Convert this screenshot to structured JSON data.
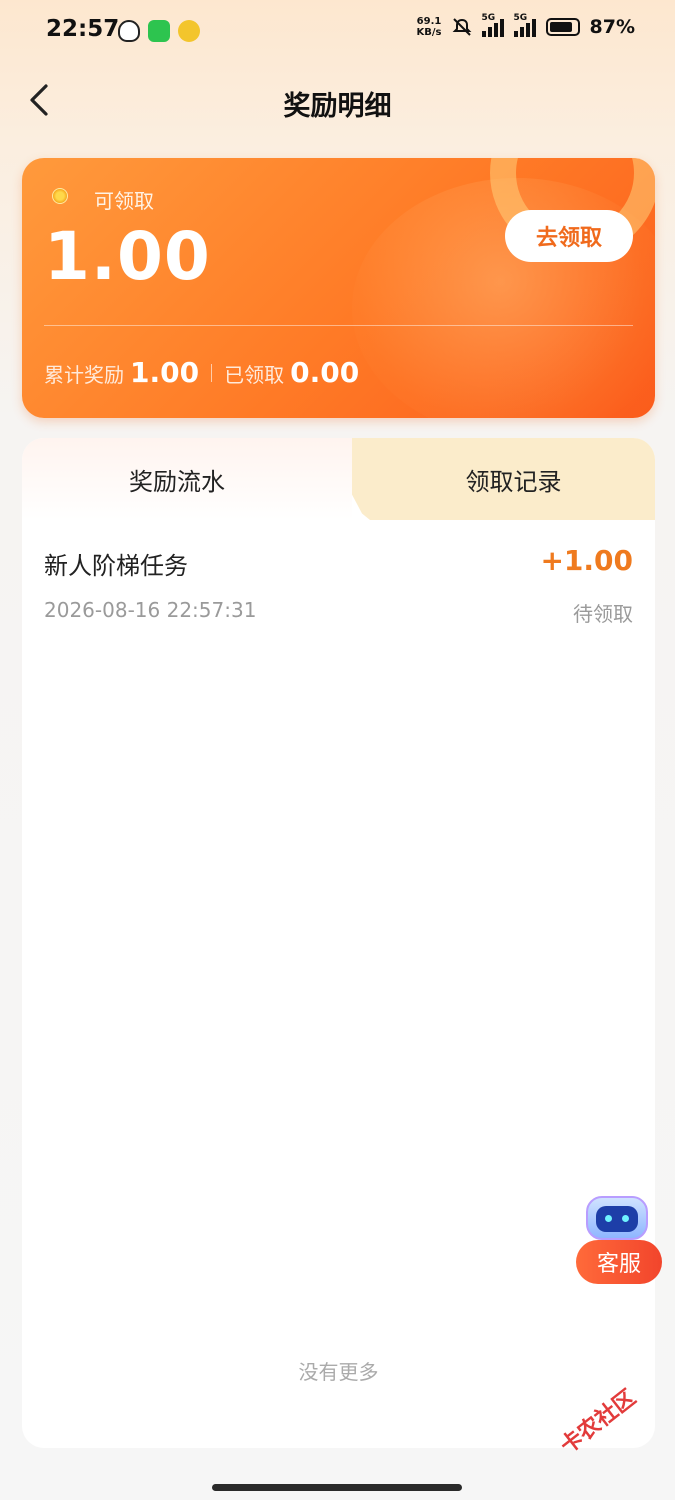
{
  "status_bar": {
    "time": "22:57",
    "net_speed_value": "69.1",
    "net_speed_unit": "KB/s",
    "signal_1": "5G",
    "signal_2": "5G",
    "battery": "87%"
  },
  "header": {
    "title": "奖励明细",
    "back_icon": "chevron-left-icon"
  },
  "reward_card": {
    "available_label": "可领取",
    "available_amount": "1.00",
    "claim_button": "去领取",
    "total_label": "累计奖励",
    "total_value": "1.00",
    "claimed_label": "已领取",
    "claimed_value": "0.00",
    "accent_color": "#ff7a26"
  },
  "tabs": [
    {
      "label": "奖励流水",
      "active": true
    },
    {
      "label": "领取记录",
      "active": false
    }
  ],
  "records": [
    {
      "title": "新人阶梯任务",
      "amount": "+1.00",
      "time": "2026-08-16 22:57:31",
      "status": "待领取"
    }
  ],
  "list_footer": "没有更多",
  "customer_service": {
    "label": "客服",
    "icon": "robot-icon"
  },
  "watermark": "卡农社区"
}
